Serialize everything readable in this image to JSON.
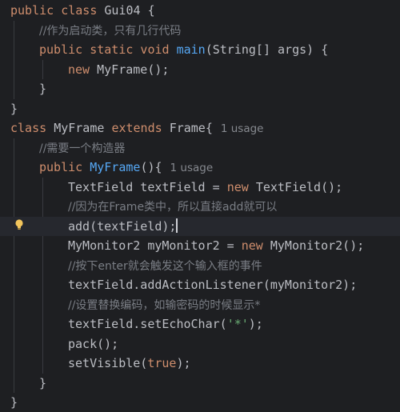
{
  "editor": {
    "lines": [
      {
        "indent": 0,
        "tokens": [
          {
            "t": "public class ",
            "c": "kw"
          },
          {
            "t": "Gui04 {",
            "c": "cls"
          }
        ]
      },
      {
        "indent": 1,
        "tokens": [
          {
            "t": "//作为启动类，只有几行代码",
            "c": "cm"
          }
        ]
      },
      {
        "indent": 1,
        "tokens": [
          {
            "t": "public static void ",
            "c": "kw"
          },
          {
            "t": "main",
            "c": "fn"
          },
          {
            "t": "(String[] args) {",
            "c": "cls"
          }
        ]
      },
      {
        "indent": 2,
        "tokens": [
          {
            "t": "new ",
            "c": "kw"
          },
          {
            "t": "MyFrame();",
            "c": "cls"
          }
        ]
      },
      {
        "indent": 1,
        "tokens": [
          {
            "t": "}",
            "c": "cls"
          }
        ]
      },
      {
        "indent": 0,
        "tokens": [
          {
            "t": "}",
            "c": "cls"
          }
        ]
      },
      {
        "indent": 0,
        "tokens": [
          {
            "t": "class ",
            "c": "kw"
          },
          {
            "t": "MyFrame ",
            "c": "cls"
          },
          {
            "t": "extends ",
            "c": "kw"
          },
          {
            "t": "Frame{",
            "c": "cls"
          },
          {
            "t": "1 usage",
            "c": "hint"
          }
        ]
      },
      {
        "indent": 1,
        "tokens": [
          {
            "t": "//需要一个构造器",
            "c": "cm"
          }
        ]
      },
      {
        "indent": 1,
        "tokens": [
          {
            "t": "public ",
            "c": "kw"
          },
          {
            "t": "MyFrame",
            "c": "fn"
          },
          {
            "t": "(){",
            "c": "cls"
          },
          {
            "t": "1 usage",
            "c": "hint"
          }
        ]
      },
      {
        "indent": 2,
        "tokens": [
          {
            "t": "TextField textField = ",
            "c": "cls"
          },
          {
            "t": "new ",
            "c": "kw"
          },
          {
            "t": "TextField();",
            "c": "cls"
          }
        ]
      },
      {
        "indent": 2,
        "tokens": [
          {
            "t": "//因为在Frame类中，所以直接add就可以",
            "c": "cm"
          }
        ]
      },
      {
        "indent": 2,
        "highlight": true,
        "caret": true,
        "tokens": [
          {
            "t": "add(textField);",
            "c": "cls"
          }
        ]
      },
      {
        "indent": 2,
        "tokens": [
          {
            "t": "MyMonitor2 myMonitor2 = ",
            "c": "cls"
          },
          {
            "t": "new ",
            "c": "kw"
          },
          {
            "t": "MyMonitor2();",
            "c": "cls"
          }
        ]
      },
      {
        "indent": 2,
        "tokens": [
          {
            "t": "//按下enter就会触发这个输入框的事件",
            "c": "cm"
          }
        ]
      },
      {
        "indent": 2,
        "tokens": [
          {
            "t": "textField.addActionListener(myMonitor2);",
            "c": "cls"
          }
        ]
      },
      {
        "indent": 2,
        "tokens": [
          {
            "t": "//设置替换编码，如输密码的时候显示*",
            "c": "cm"
          }
        ]
      },
      {
        "indent": 2,
        "tokens": [
          {
            "t": "textField.setEchoChar(",
            "c": "cls"
          },
          {
            "t": "'*'",
            "c": "str"
          },
          {
            "t": ");",
            "c": "cls"
          }
        ]
      },
      {
        "indent": 2,
        "tokens": [
          {
            "t": "pack();",
            "c": "cls"
          }
        ]
      },
      {
        "indent": 2,
        "tokens": [
          {
            "t": "setVisible(",
            "c": "cls"
          },
          {
            "t": "true",
            "c": "kw"
          },
          {
            "t": ");",
            "c": "cls"
          }
        ]
      },
      {
        "indent": 1,
        "tokens": [
          {
            "t": "}",
            "c": "cls"
          }
        ]
      },
      {
        "indent": 0,
        "tokens": [
          {
            "t": "}",
            "c": "cls"
          }
        ]
      }
    ],
    "gutter_icon": "lightbulb-icon"
  }
}
